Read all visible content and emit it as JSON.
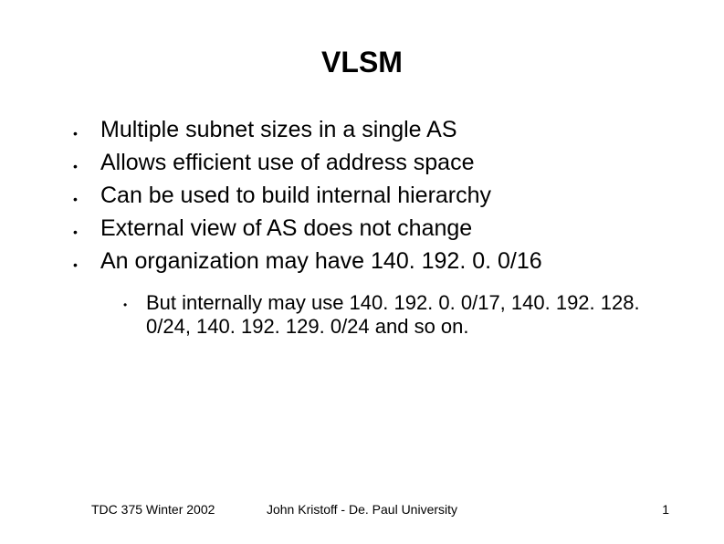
{
  "title": "VLSM",
  "bullets": [
    "Multiple subnet sizes in a single AS",
    "Allows efficient use of address space",
    "Can be used to build internal hierarchy",
    "External view of AS does not change",
    "An organization may have 140. 192. 0. 0/16"
  ],
  "sub_bullet": "But internally may use 140. 192. 0. 0/17, 140. 192. 128. 0/24, 140. 192. 129. 0/24 and so on.",
  "footer": {
    "left": "TDC 375 Winter 2002",
    "center": "John Kristoff - De. Paul University",
    "right": "1"
  }
}
